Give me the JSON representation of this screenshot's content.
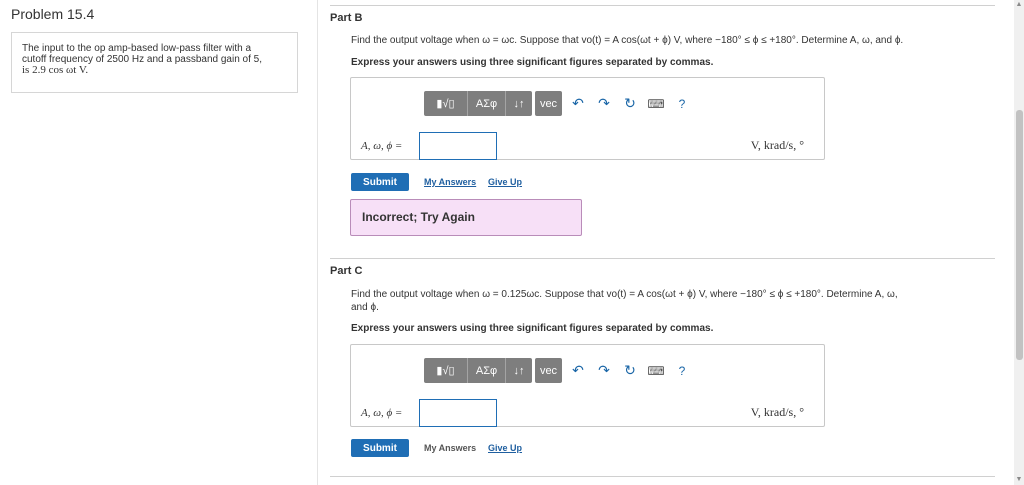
{
  "problem": {
    "title": "Problem 15.4",
    "text_lines": [
      "The input to the op amp-based low-pass filter with a",
      "cutoff frequency of 2500 Hz and a passband gain of 5,",
      "is 2.9 cos ωt V."
    ]
  },
  "toolbar": {
    "templates_glyph": "▮√▯",
    "greek_label": "ΑΣφ",
    "arrows_glyph": "↓↑",
    "vec_label": "vec",
    "undo_icon": "undo-icon",
    "redo_icon": "redo-icon",
    "reset_icon": "reset-icon",
    "keyboard_icon": "keyboard-icon",
    "help_label": "?"
  },
  "partB": {
    "label": "Part B",
    "question": "Find the output voltage when ω = ωc. Suppose that vo(t) = A cos(ωt + ϕ) V, where −180° ≤ ϕ ≤ +180°. Determine A, ω, and ϕ.",
    "instruction": "Express your answers using three significant figures separated by commas.",
    "answer_label": "A, ω, ϕ =",
    "units": "V, krad/s, °",
    "submit": "Submit",
    "my_answers": "My Answers",
    "give_up": "Give Up",
    "feedback": "Incorrect; Try Again"
  },
  "partC": {
    "label": "Part C",
    "question_line1": "Find the output voltage when ω = 0.125ωc. Suppose that vo(t) = A cos(ωt + ϕ) V, where −180° ≤ ϕ ≤ +180°. Determine A, ω,",
    "question_line2": "and ϕ.",
    "instruction": "Express your answers using three significant figures separated by commas.",
    "answer_label": "A, ω, ϕ =",
    "units": "V, krad/s, °",
    "submit": "Submit",
    "my_answers": "My Answers",
    "give_up": "Give Up"
  },
  "colors": {
    "accent": "#1f6eb5",
    "feedback_bg": "#f7e0f7",
    "toolbar_gray": "#7e7e7e"
  }
}
